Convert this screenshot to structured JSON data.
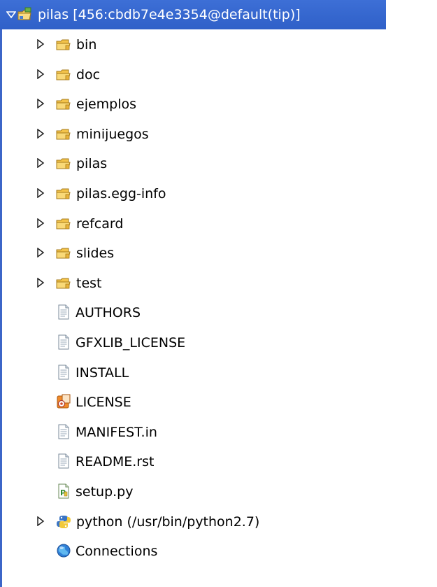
{
  "tree": {
    "root": {
      "label": "pilas [456:cbdb7e4e3354@default(tip)]",
      "icon": "project-folder-icon",
      "expanded": true
    },
    "folders": [
      {
        "label": "bin",
        "icon": "folder-icon"
      },
      {
        "label": "doc",
        "icon": "folder-icon"
      },
      {
        "label": "ejemplos",
        "icon": "folder-icon"
      },
      {
        "label": "minijuegos",
        "icon": "folder-icon"
      },
      {
        "label": "pilas",
        "icon": "folder-icon"
      },
      {
        "label": "pilas.egg-info",
        "icon": "folder-icon"
      },
      {
        "label": "refcard",
        "icon": "folder-icon"
      },
      {
        "label": "slides",
        "icon": "folder-icon"
      },
      {
        "label": "test",
        "icon": "folder-icon"
      }
    ],
    "files": [
      {
        "label": "AUTHORS",
        "icon": "text-file-icon"
      },
      {
        "label": "GFXLIB_LICENSE",
        "icon": "text-file-icon"
      },
      {
        "label": "INSTALL",
        "icon": "text-file-icon"
      },
      {
        "label": "LICENSE",
        "icon": "license-file-icon"
      },
      {
        "label": "MANIFEST.in",
        "icon": "text-file-icon"
      },
      {
        "label": "README.rst",
        "icon": "text-file-icon"
      },
      {
        "label": "setup.py",
        "icon": "python-file-icon"
      }
    ],
    "interpreter": {
      "label": "python  (/usr/bin/python2.7)",
      "icon": "python-interpreter-icon"
    },
    "connections": {
      "label": "Connections",
      "icon": "connections-icon"
    }
  },
  "colors": {
    "selection": "#3068cc",
    "folder": "#f2c24a",
    "border": "#3c66c8"
  }
}
